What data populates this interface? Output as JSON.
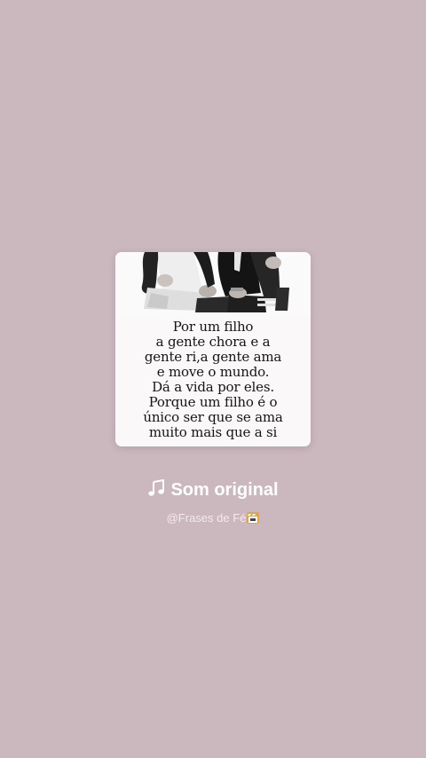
{
  "card": {
    "quote_lines": [
      "Por um filho",
      "a gente chora e a",
      "gente ri,a gente ama",
      "e move o mundo.",
      "Dá a vida por eles.",
      "Porque um filho é o",
      "único ser que se ama",
      "muito mais que a si"
    ],
    "image_icon": "family-photo"
  },
  "audio": {
    "title": "Som original",
    "icon": "music-note-icon",
    "author": "@Frases de Fé",
    "author_icon": "clapperboard-emoji-icon"
  },
  "colors": {
    "background": "#cbb7be",
    "card": "#faf8f8",
    "text_light": "#ffffff"
  }
}
